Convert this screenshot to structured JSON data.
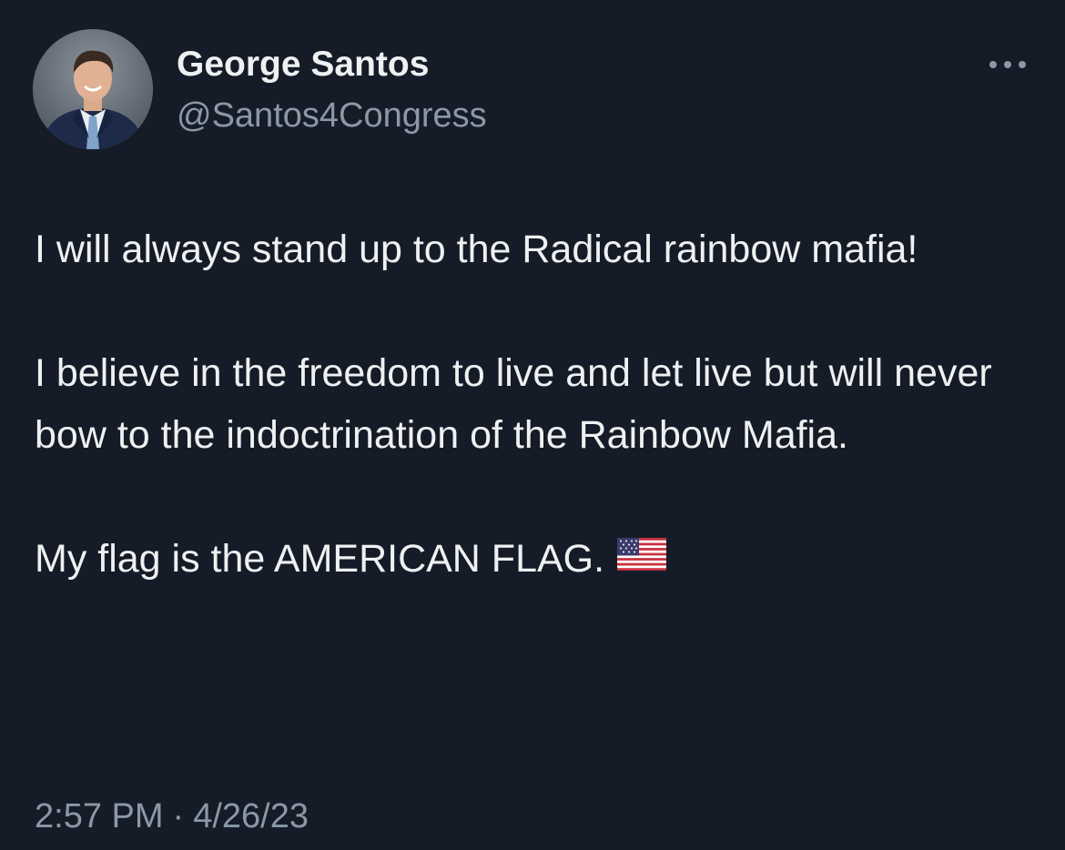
{
  "author": {
    "name": "George Santos",
    "handle": "@Santos4Congress",
    "avatar_icon": "profile-photo"
  },
  "menu": {
    "icon": "more-horizontal-icon"
  },
  "tweet": {
    "paragraphs": [
      "I will always stand up to the Radical rainbow mafia!",
      "I believe in the freedom to live and let live but will never bow to the indoctrination of the Rainbow Mafia.",
      "My flag is the AMERICAN FLAG."
    ],
    "emoji": "us-flag-emoji"
  },
  "meta": {
    "time": "2:57 PM",
    "separator": "·",
    "date": "4/26/23"
  },
  "colors": {
    "background": "#151c28",
    "text": "#eef0f1",
    "secondary_text": "#8b98a5"
  }
}
